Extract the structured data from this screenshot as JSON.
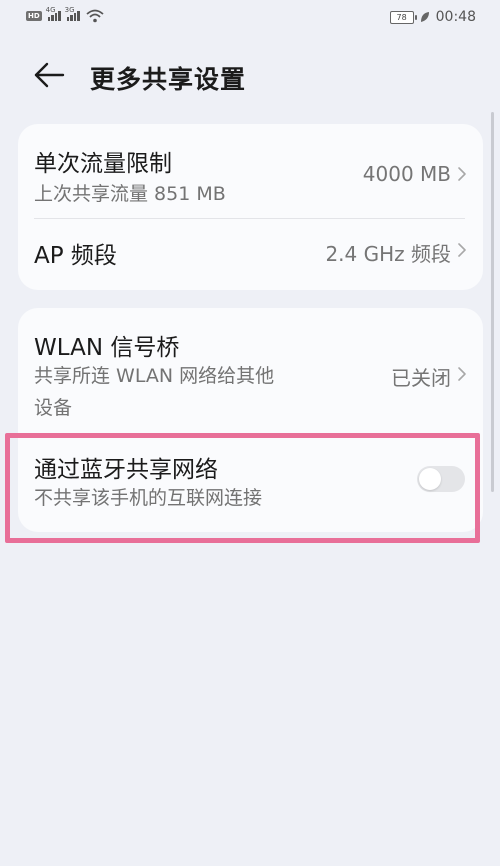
{
  "status_bar": {
    "left_chip": "HD",
    "net1": "4G",
    "net2": "3G",
    "battery": "78",
    "time": "00:48"
  },
  "header": {
    "title": "更多共享设置"
  },
  "card1": {
    "row1": {
      "title": "单次流量限制",
      "subtitle": "上次共享流量 851 MB",
      "value": "4000 MB"
    },
    "row2": {
      "title": "AP 频段",
      "value": "2.4 GHz 频段"
    }
  },
  "card2": {
    "row1": {
      "title": "WLAN 信号桥",
      "subtitle_line1": "共享所连 WLAN 网络给其他",
      "subtitle_line2": "设备",
      "value": "已关闭"
    },
    "row2": {
      "title": "通过蓝牙共享网络",
      "subtitle": "不共享该手机的互联网连接",
      "toggle_on": false
    }
  },
  "colors": {
    "background": "#eef0f6",
    "card": "#fafbfd",
    "highlight": "#e86f98",
    "toggle_off": "#e4e5e8"
  },
  "icons": {
    "back": "arrow-left-icon",
    "chevron": "chevron-right-icon",
    "wifi": "wifi-icon",
    "leaf": "leaf-icon",
    "signal": "signal-icon"
  }
}
